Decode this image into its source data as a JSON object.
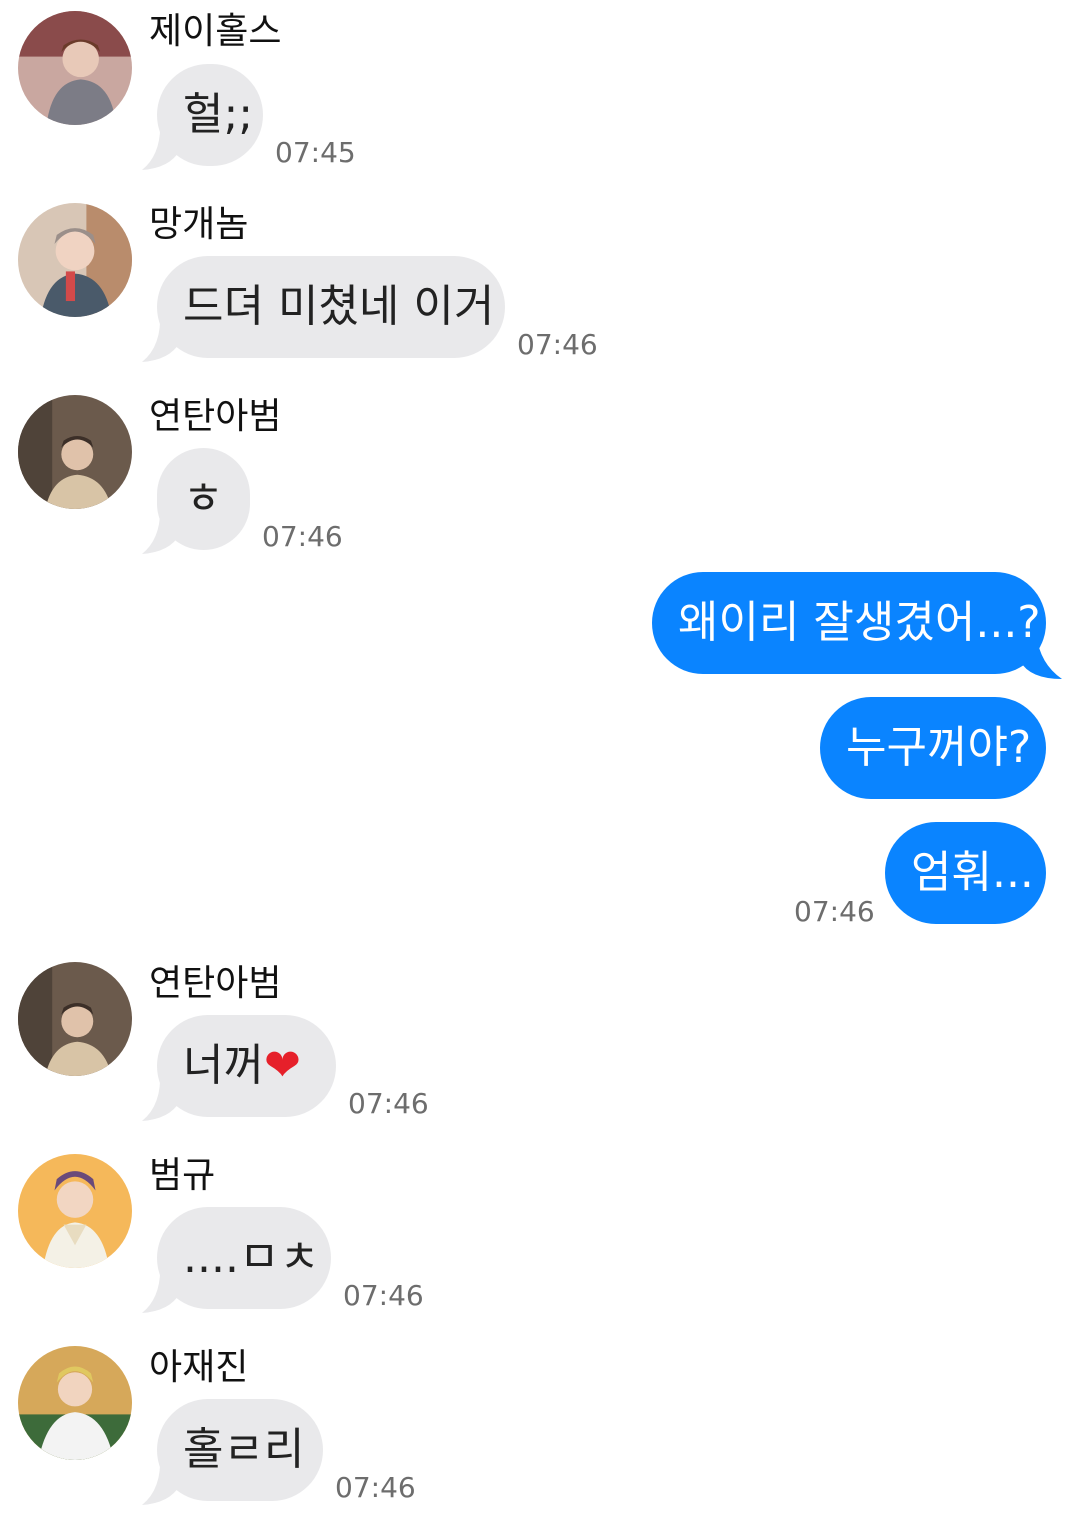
{
  "colors": {
    "incoming_bubble": "#e9e9eb",
    "outgoing_bubble": "#0a84ff",
    "timestamp": "#6d6d6d"
  },
  "incoming": [
    {
      "sender": "제이홀스",
      "text": "헐;;",
      "time": "07:45",
      "avatar": "avatar-photo-icon"
    },
    {
      "sender": "망개놈",
      "text": "드뎌 미쳤네 이거",
      "time": "07:46",
      "avatar": "avatar-photo-icon"
    },
    {
      "sender": "연탄아범",
      "text": "ㅎ",
      "time": "07:46",
      "avatar": "avatar-photo-icon"
    }
  ],
  "outgoing": {
    "messages": [
      "왜이리 잘생겼어...?",
      "누구꺼야?",
      "엄훠..."
    ],
    "time": "07:46"
  },
  "incoming2": [
    {
      "sender": "연탄아범",
      "text": "너꺼",
      "emoji": "❤",
      "time": "07:46",
      "avatar": "avatar-photo-icon"
    },
    {
      "sender": "범규",
      "text": "....ㅁㅊ",
      "time": "07:46",
      "avatar": "avatar-photo-icon"
    },
    {
      "sender": "아재진",
      "text": "홀ㄹ리",
      "time": "07:46",
      "avatar": "avatar-photo-icon"
    }
  ]
}
